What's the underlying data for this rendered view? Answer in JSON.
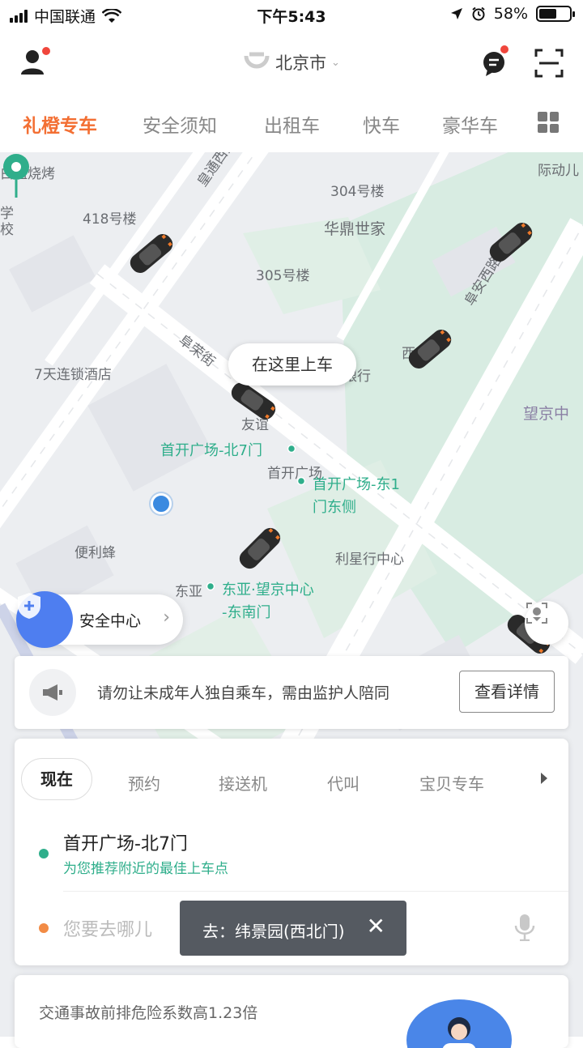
{
  "status_bar": {
    "carrier": "中国联通",
    "time": "下午5:43",
    "battery": "58%",
    "battery_level": 0.58
  },
  "header": {
    "city": "北京市"
  },
  "tabs": [
    "礼橙专车",
    "安全须知",
    "出租车",
    "快车",
    "豪华车"
  ],
  "map": {
    "labels": {
      "l1": "白姐烧烤",
      "l2": "418号楼",
      "l3": "304号楼",
      "l4": "华鼎世家",
      "l5": "305号楼",
      "l6": "7天连锁酒店",
      "l7": "银行",
      "l8": "友谊",
      "l9": "首开广场",
      "l10": "便利蜂",
      "l11": "利星行中心",
      "l12": "东亚",
      "l13": "望京中",
      "l14": "皇通西大",
      "l15": "阜荣街",
      "l16": "阜安西路",
      "l17": "际动儿",
      "l18": "学校",
      "l19": "西"
    },
    "green_labels": {
      "g1": "首开广场-北7门",
      "g2a": "首开广场-东1",
      "g2b": "门东侧",
      "g3a": "东亚·望京中心",
      "g3b": "-东南门"
    },
    "pickup_bubble": "在这里上车"
  },
  "safety_center": {
    "label": "安全中心"
  },
  "notice": {
    "text": "请勿让未成年人独自乘车，需由监护人陪同",
    "button": "查看详情"
  },
  "booking": {
    "tabs": [
      "现在",
      "预约",
      "接送机",
      "代叫",
      "宝贝专车"
    ],
    "from_name": "首开广场-北7门",
    "from_hint": "为您推荐附近的最佳上车点",
    "to_placeholder": "您要去哪儿"
  },
  "toast": {
    "text": "去：纬景园(西北门)",
    "close": "✕"
  },
  "bottom_card": {
    "text": "交通事故前排危险系数高1.23倍"
  },
  "colors": {
    "accent_orange": "#f36f33",
    "green": "#2fae8b",
    "blue": "#4e7ef0"
  }
}
